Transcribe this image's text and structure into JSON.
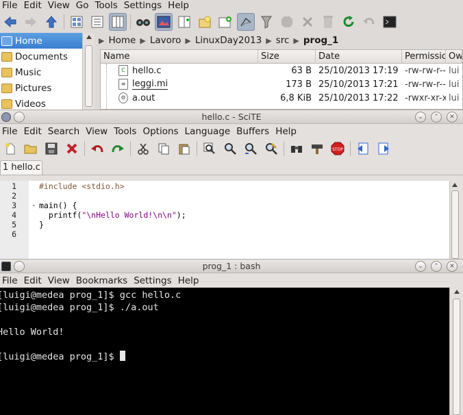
{
  "file_manager": {
    "menu": [
      "File",
      "Edit",
      "View",
      "Go",
      "Tools",
      "Settings",
      "Help"
    ],
    "toolbar_icons": [
      "back-arrow-icon",
      "forward-arrow-icon",
      "up-arrow-icon",
      "icons-view-icon",
      "details-view-icon",
      "columns-view-icon",
      "find-icon",
      "preview-icon",
      "split-icon",
      "new-file-icon",
      "new-folder-icon",
      "new-tab-icon",
      "draw-icon",
      "filter-icon",
      "shape-icon",
      "delete-icon",
      "trash-icon",
      "reload-icon",
      "undo-icon",
      "terminal-icon"
    ],
    "places": [
      "Home",
      "Documents",
      "Music",
      "Pictures",
      "Videos"
    ],
    "breadcrumb": [
      "Home",
      "Lavoro",
      "LinuxDay2013",
      "src",
      "prog_1"
    ],
    "columns": [
      "Name",
      "Size",
      "Date",
      "Permissic",
      "Ow"
    ],
    "files": [
      {
        "name": "hello.c",
        "size": "63 B",
        "date": "25/10/2013 17:19",
        "perm": "-rw-rw-r--",
        "owner": "lui"
      },
      {
        "name": "leggi.mi",
        "size": "173 B",
        "date": "25/10/2013 17:21",
        "perm": "-rw-rw-r--",
        "owner": "lui"
      },
      {
        "name": "a.out",
        "size": "6,8 KiB",
        "date": "25/10/2013 17:22",
        "perm": "-rwxr-xr-x",
        "owner": "lui"
      }
    ]
  },
  "scite": {
    "title": "hello.c - SciTE",
    "menu": [
      "File",
      "Edit",
      "Search",
      "View",
      "Tools",
      "Options",
      "Language",
      "Buffers",
      "Help"
    ],
    "toolbar_icons": [
      "new-icon",
      "open-icon",
      "save-icon",
      "close-icon",
      "undo-icon",
      "redo-icon",
      "cut-icon",
      "copy-icon",
      "paste-icon",
      "zoom-icon",
      "find-icon",
      "find-next-icon",
      "replace-icon",
      "binoculars-icon",
      "build-icon",
      "stop-icon",
      "prev-bookmark-icon",
      "next-bookmark-icon"
    ],
    "tab": "1 hello.c",
    "lines": [
      {
        "num": "1",
        "fold": "",
        "text": "#include <stdio.h>"
      },
      {
        "num": "2",
        "fold": "",
        "text": ""
      },
      {
        "num": "3",
        "fold": "-",
        "text": "main() {"
      },
      {
        "num": "4",
        "fold": "",
        "text": "  printf(\"\\nHello World!\\n\\n\");"
      },
      {
        "num": "5",
        "fold": "",
        "text": "}"
      },
      {
        "num": "6",
        "fold": "",
        "text": ""
      }
    ]
  },
  "konsole": {
    "title": "prog_1 : bash",
    "menu": [
      "File",
      "Edit",
      "View",
      "Bookmarks",
      "Settings",
      "Help"
    ],
    "lines": [
      "[luigi@medea prog_1]$ gcc hello.c",
      "[luigi@medea prog_1]$ ./a.out",
      "",
      "Hello World!",
      "",
      "[luigi@medea prog_1]$ "
    ]
  },
  "colors": {
    "selection": "#3a7fd0",
    "terminal_bg": "#000000",
    "terminal_fg": "#e6e6e6",
    "string": "#7f007f",
    "preprocessor": "#7f5a3a"
  }
}
